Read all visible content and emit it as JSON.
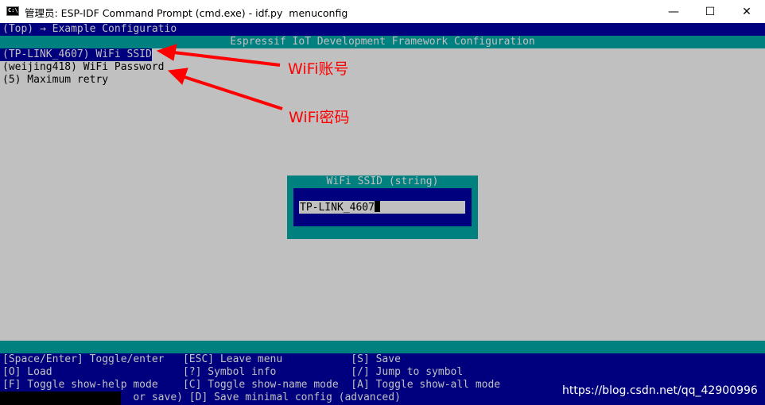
{
  "window": {
    "title": "管理员: ESP-IDF Command Prompt (cmd.exe) - idf.py  menuconfig",
    "icon_label": "C:\\",
    "min_glyph": "—",
    "max_glyph": "☐",
    "close_glyph": "✕"
  },
  "menuconfig": {
    "breadcrumb": "(Top) → Example Configuratio",
    "title": "Espressif IoT Development Framework Configuration",
    "items": [
      {
        "text": "(TP-LINK_4607) WiFi SSID",
        "selected": true
      },
      {
        "text": "(weijing418) WiFi Password",
        "selected": false
      },
      {
        "text": "(5) Maximum retry",
        "selected": false
      }
    ]
  },
  "annotations": {
    "ssid": "WiFi账号",
    "password": "WiFi密码"
  },
  "dialog": {
    "title": "WiFi SSID (string)",
    "value": "TP-LINK_4607"
  },
  "help": {
    "rows": [
      "[Space/Enter] Toggle/enter   [ESC] Leave menu           [S] Save",
      "[O] Load                     [?] Symbol info            [/] Jump to symbol",
      "[F] Toggle show-help mode    [C] Toggle show-name mode  [A] Toggle show-all mode",
      "                     or save) [D] Save minimal config (advanced)"
    ]
  },
  "watermark": "https://blog.csdn.net/qq_42900996",
  "colors": {
    "console_bg": "#c0c0c0",
    "navy": "#00007e",
    "teal": "#00807f",
    "annotation": "#ff0000"
  }
}
